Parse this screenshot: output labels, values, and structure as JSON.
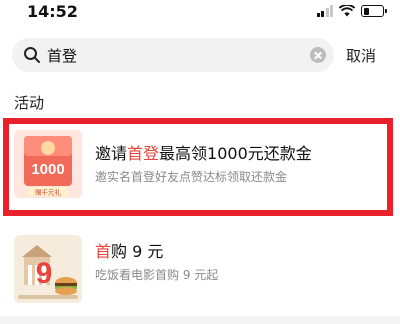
{
  "status_bar": {
    "time": "14:52",
    "battery_level": 0.3
  },
  "search": {
    "query": "首登",
    "cancel_label": "取消"
  },
  "section": {
    "title": "活动"
  },
  "results": [
    {
      "title_prefix": "邀请",
      "title_highlight": "首登",
      "title_suffix": "最高领1000元还款金",
      "description": "邀实名首登好友点赞达标领取还款金",
      "thumb_text": "1000",
      "thumb_caption": "赠千元礼"
    },
    {
      "title_prefix": "",
      "title_highlight": "首",
      "title_suffix": "购 9 元",
      "description": "吃饭看电影首购 9 元起",
      "thumb_text": "9"
    }
  ],
  "colors": {
    "highlight_text": "#e8453c",
    "selection_border": "#e8212a"
  }
}
